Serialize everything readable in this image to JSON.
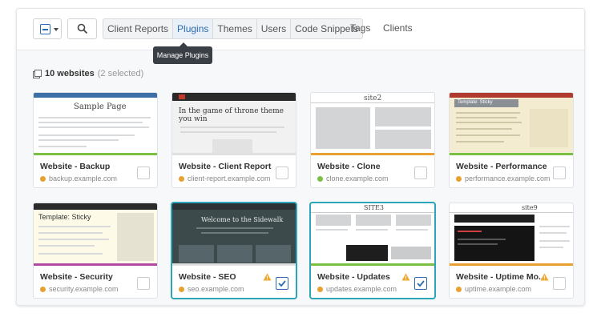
{
  "toolbar": {
    "tabs": [
      "Client Reports",
      "Plugins",
      "Themes",
      "Users",
      "Code Snippets"
    ],
    "active_tab": "Plugins",
    "extra_tabs": [
      "Tags",
      "Clients"
    ],
    "tooltip": "Manage Plugins"
  },
  "summary": {
    "count_label": "10 websites",
    "selected_label": "(2 selected)"
  },
  "colors": {
    "accent": "#2b6cb0",
    "selected_border": "#2ba6b8",
    "status_orange": "#e8a030",
    "status_green": "#7ac043",
    "warning": "#f0a830"
  },
  "cards": [
    {
      "title": "Website - Backup",
      "url": "backup.example.com",
      "status": "orange",
      "checked": false,
      "warning": false,
      "stripe": "#7ac043",
      "thumb_text": "Sample Page"
    },
    {
      "title": "Website - Client Report",
      "url": "client-report.example.com",
      "status": "orange",
      "checked": false,
      "warning": false,
      "stripe": "#e0e0e0",
      "thumb_text": "In the game of throne theme you win"
    },
    {
      "title": "Website - Clone",
      "url": "clone.example.com",
      "status": "green",
      "checked": false,
      "warning": false,
      "stripe": "#e8a030",
      "thumb_text": "site2"
    },
    {
      "title": "Website - Performance",
      "url": "performance.example.com",
      "status": "orange",
      "checked": false,
      "warning": false,
      "stripe": "#7ac043",
      "thumb_text": "Template: Sticky"
    },
    {
      "title": "Website - Security",
      "url": "security.example.com",
      "status": "orange",
      "checked": false,
      "warning": false,
      "stripe": "#7ac043",
      "thumb_text": "Template: Sticky"
    },
    {
      "title": "Website - SEO",
      "url": "seo.example.com",
      "status": "orange",
      "checked": true,
      "warning": true,
      "stripe": "#e0e0e0",
      "thumb_text": "Welcome to the Sidewalk"
    },
    {
      "title": "Website - Updates",
      "url": "updates.example.com",
      "status": "orange",
      "checked": true,
      "warning": true,
      "stripe": "#7ac043",
      "thumb_text": "SITE3"
    },
    {
      "title": "Website - Uptime Mo...",
      "url": "uptime.example.com",
      "status": "orange",
      "checked": false,
      "warning": true,
      "stripe": "#e8a030",
      "thumb_text": "site9"
    }
  ]
}
